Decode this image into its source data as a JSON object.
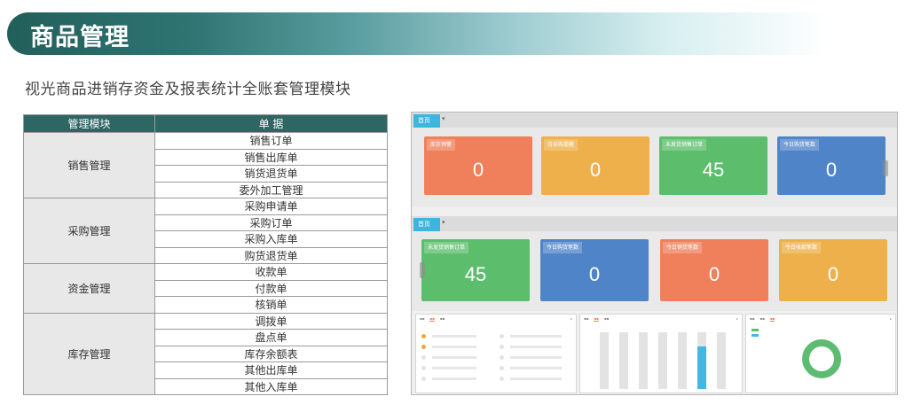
{
  "header": {
    "title": "商品管理",
    "subtitle": "视光商品进销存资金及报表统计全账套管理模块"
  },
  "table": {
    "headers": [
      "管理模块",
      "单 据"
    ],
    "groups": [
      {
        "module": "销售管理",
        "items": [
          "销售订单",
          "销售出库单",
          "销货退货单",
          "委外加工管理"
        ]
      },
      {
        "module": "采购管理",
        "items": [
          "采购申请单",
          "采购订单",
          "采购入库单",
          "购货退货单"
        ]
      },
      {
        "module": "资金管理",
        "items": [
          "收款单",
          "付款单",
          "核销单"
        ]
      },
      {
        "module": "库存管理",
        "items": [
          "调拨单",
          "盘点单",
          "库存余额表",
          "其他出库单",
          "其他入库单"
        ]
      }
    ]
  },
  "screenshot": {
    "tab_label": "首页",
    "row1": [
      {
        "label": "库存预警",
        "value": "0",
        "color": "#f07f5c"
      },
      {
        "label": "待采购提醒",
        "value": "0",
        "color": "#edb04b"
      },
      {
        "label": "未发货销售订单",
        "value": "45",
        "color": "#5cbe6d"
      },
      {
        "label": "今日购货笔数",
        "value": "0",
        "color": "#5084c9"
      }
    ],
    "row2": [
      {
        "label": "未发货销售订单",
        "value": "45",
        "color": "#5cbe6d"
      },
      {
        "label": "今日购货笔数",
        "value": "0",
        "color": "#5084c9"
      },
      {
        "label": "今日销货笔数",
        "value": "0",
        "color": "#f07f5c"
      },
      {
        "label": "今日收款笔数",
        "value": "0",
        "color": "#edb04b"
      }
    ]
  }
}
